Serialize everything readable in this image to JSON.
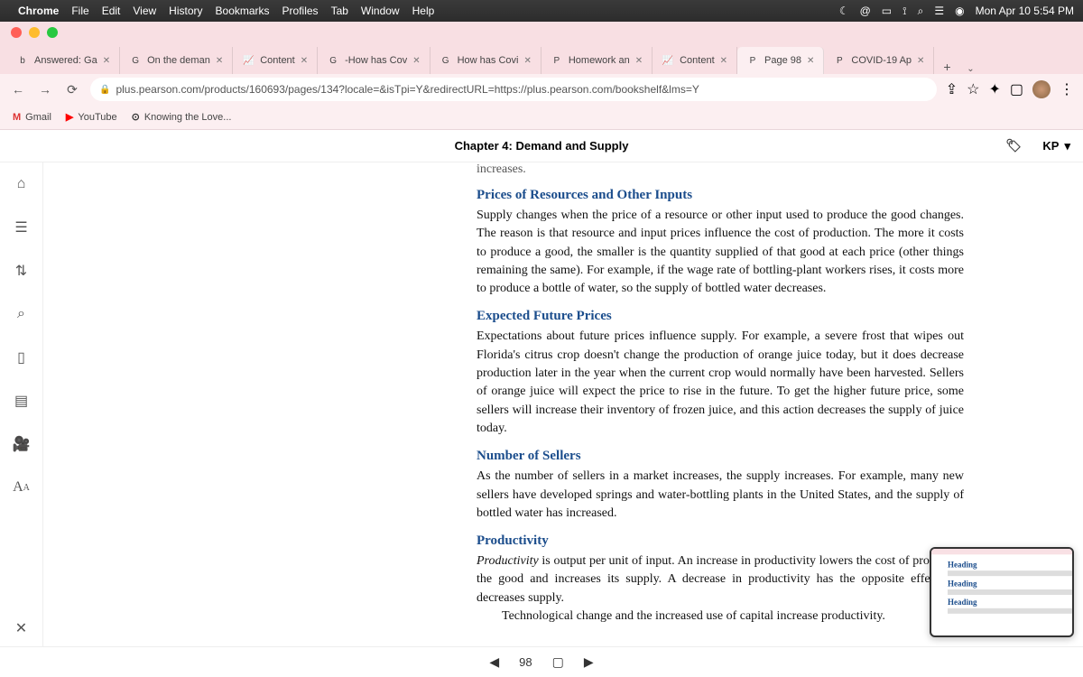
{
  "mac": {
    "menus": [
      "Chrome",
      "File",
      "Edit",
      "View",
      "History",
      "Bookmarks",
      "Profiles",
      "Tab",
      "Window",
      "Help"
    ],
    "clock": "Mon Apr 10  5:54 PM"
  },
  "tabs": [
    {
      "favicon": "b",
      "label": "Answered: Ga"
    },
    {
      "favicon": "G",
      "label": "On the deman"
    },
    {
      "favicon": "📈",
      "label": "Content"
    },
    {
      "favicon": "G",
      "label": "-How has Cov"
    },
    {
      "favicon": "G",
      "label": "How has Covi"
    },
    {
      "favicon": "P",
      "label": "Homework an"
    },
    {
      "favicon": "📈",
      "label": "Content"
    },
    {
      "favicon": "P",
      "label": "Page 98",
      "active": true
    },
    {
      "favicon": "P",
      "label": "COVID-19 Ap"
    }
  ],
  "url": "plus.pearson.com/products/160693/pages/134?locale=&isTpi=Y&redirectURL=https://plus.pearson.com/bookshelf&lms=Y",
  "bookmarks": [
    {
      "icon": "M",
      "label": "Gmail",
      "color": "#d33"
    },
    {
      "icon": "▶",
      "label": "YouTube",
      "color": "#f00"
    },
    {
      "icon": "⊙",
      "label": "Knowing the Love...",
      "color": "#333"
    }
  ],
  "reader": {
    "chapter_title": "Chapter 4: Demand and Supply",
    "user_badge": "KP",
    "truncated_top": "increases.",
    "sections": [
      {
        "heading": "Prices of Resources and Other Inputs",
        "body": "Supply changes when the price of a resource or other input used to produce the good changes. The reason is that resource and input prices influence the cost of production. The more it costs to produce a good, the smaller is the quantity supplied of that good at each price (other things remaining the same). For example, if the wage rate of bottling-plant workers rises, it costs more to produce a bottle of water, so the supply of bottled water decreases."
      },
      {
        "heading": "Expected Future Prices",
        "body": "Expectations about future prices influence supply. For example, a severe frost that wipes out Florida's citrus crop doesn't change the production of orange juice today, but it does decrease production later in the year when the current crop would normally have been harvested. Sellers of orange juice will expect the price to rise in the future. To get the higher future price, some sellers will increase their inventory of frozen juice, and this action decreases the supply of juice today."
      },
      {
        "heading": "Number of Sellers",
        "body": "As the number of sellers in a market increases, the supply increases. For example, many new sellers have developed springs and water-bottling plants in the United States, and the supply of bottled water has increased."
      },
      {
        "heading": "Productivity",
        "body_keyword": "Productivity",
        "body_rest": " is output per unit of input. An increase in productivity lowers the cost of producing the good and increases its supply. A decrease in productivity has the opposite effect and decreases supply.",
        "body_tail": "Technological change and the increased use of capital increase productivity."
      }
    ],
    "page_number": "98"
  }
}
